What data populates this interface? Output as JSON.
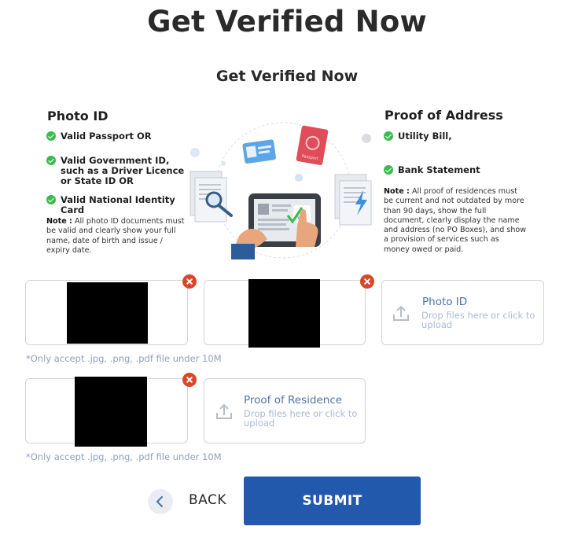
{
  "header": {
    "title": "Get Verified Now",
    "subtitle": "Get Verified Now"
  },
  "photo_id": {
    "title": "Photo ID",
    "items": [
      "Valid Passport  OR",
      "Valid Government ID, such as a Driver Licence or State ID OR",
      "Valid National Identity Card"
    ],
    "note_label": "Note :",
    "note_text": " All photo ID documents must be valid and clearly show your full name, date of birth and issue / expiry date."
  },
  "proof_address": {
    "title": "Proof of Address",
    "items": [
      "Utility Bill,",
      "Bank Statement"
    ],
    "note_label": "Note :",
    "note_text": " All proof of residences must be current and not outdated by more than 90 days, show the full document, clearly display the name and address (no PO Boxes), and show a provision of services such as money owed or paid."
  },
  "illustration": {
    "passport_label": "Passport",
    "email_symbol": "@"
  },
  "uploads": {
    "photo_id": {
      "title": "Photo ID",
      "hint": "Drop files here or click to upload"
    },
    "residence": {
      "title": "Proof of Residence",
      "hint": "Drop files here or click to upload"
    },
    "accept_note": "*Only accept .jpg, .png, .pdf file under 10M"
  },
  "actions": {
    "back_label": "BACK",
    "submit_label": "SUBMIT"
  },
  "colors": {
    "accent": "#2259ad",
    "check": "#3dba4e",
    "remove": "#d9472b",
    "drop_title": "#4d73a8",
    "hint": "#a9bbd3"
  }
}
